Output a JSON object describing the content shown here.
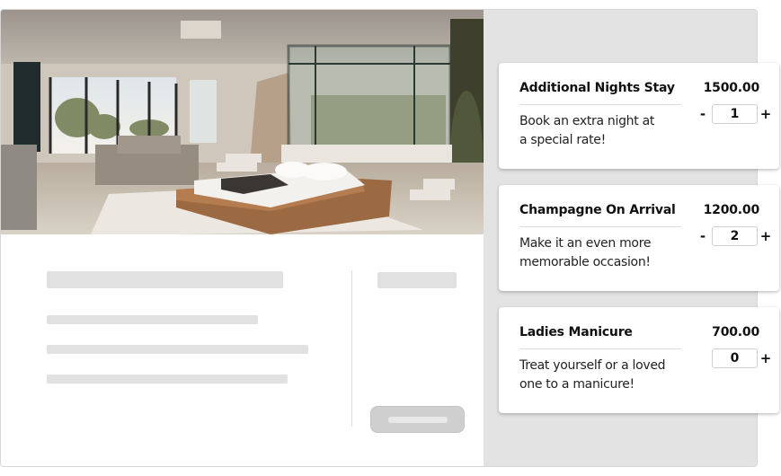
{
  "photo": {
    "alt": "Modern bedroom suite with glass shower enclosure and desert view"
  },
  "addons": [
    {
      "title": "Additional Nights Stay",
      "price": "1500.00",
      "desc_line1": "Book an extra night at",
      "desc_line2": "a special rate!",
      "quantity": "1",
      "minus_label": "-",
      "plus_label": "+"
    },
    {
      "title": "Champagne On Arrival",
      "price": "1200.00",
      "desc_line1": "Make it an even more",
      "desc_line2": "memorable occasion!",
      "quantity": "2",
      "minus_label": "-",
      "plus_label": "+"
    },
    {
      "title": "Ladies Manicure",
      "price": "700.00",
      "desc_line1": "Treat yourself or a loved",
      "desc_line2": "one to a manicure!",
      "quantity": "0",
      "plus_label": "+"
    }
  ],
  "colors": {
    "panel_bg": "#e3e3e3",
    "skeleton": "#e1e1e1",
    "skeleton_button": "#cfcfcf"
  }
}
